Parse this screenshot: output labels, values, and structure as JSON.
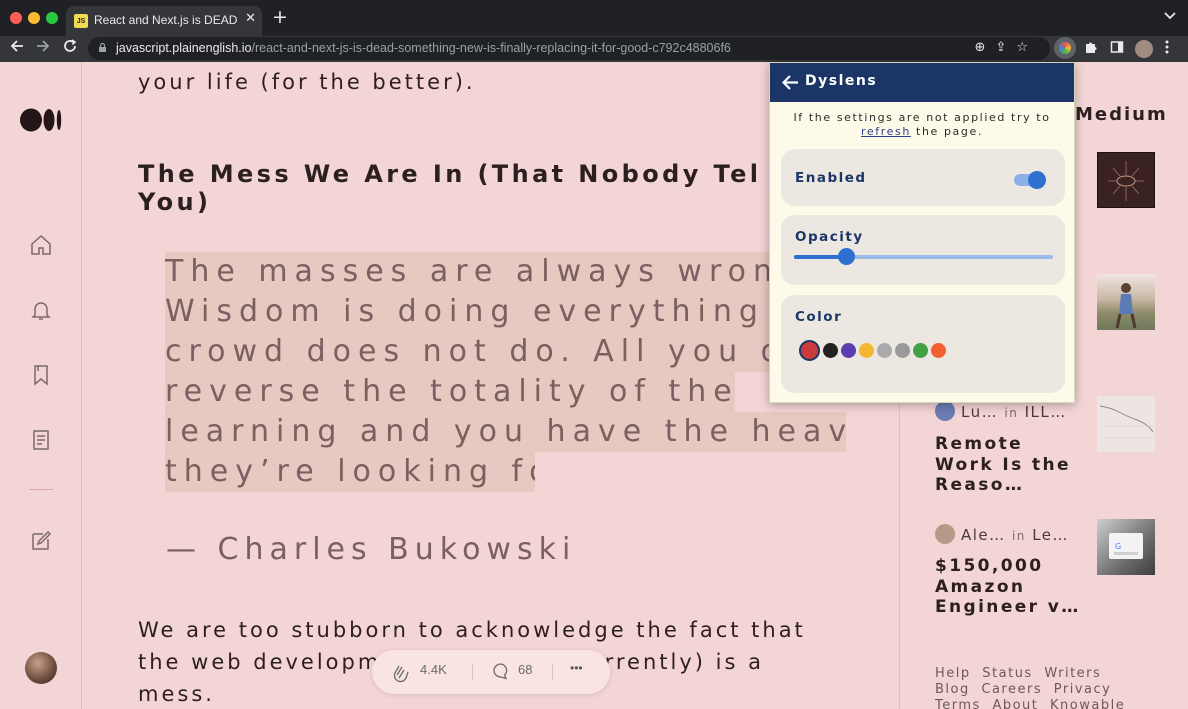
{
  "browser": {
    "tab_title": "React and Next.js is DEAD — Something New Is Finally Replacing It",
    "tab_favicon_text": "JS",
    "tab_close": "✕",
    "new_tab": "+",
    "url_domain": "javascript.plainenglish.io",
    "url_path": "/react-and-next-js-is-dead-something-new-is-finally-replacing-it-for-good-c792c48806f6",
    "icons": [
      "arrow-left-icon",
      "arrow-right-icon",
      "reload-icon",
      "lock-icon",
      "zoom-icon",
      "share-icon",
      "star-icon",
      "dyslens-extension-icon",
      "puzzle-icon",
      "side-panel-icon",
      "profile-avatar",
      "more-menu-icon"
    ]
  },
  "article": {
    "intro_tail": "your life (for the better).",
    "heading_line1": "The Mess We Are In (That Nobody Tel",
    "heading_line2": "You)",
    "quote_lines": [
      "The masses are always wrong.",
      "Wisdom is doing everything th",
      "crowd does not do. All you do",
      "reverse the totality of their",
      "learning and you have the heaven",
      "they’re looking for."
    ],
    "quote_attribution": "— Charles Bukowski",
    "paragraph": "We are too stubborn to acknowledge the fact that the web development situation (currently) is a mess."
  },
  "clap_bar": {
    "claps": "4.4K",
    "responses": "68",
    "more": "•••"
  },
  "right_column": {
    "heading_fragment": "Medium",
    "stories": [
      {
        "author": "Lu…",
        "in_word": "in",
        "publication": "ILL…",
        "title": "Remote Work Is the Reaso…"
      },
      {
        "author": "Ale…",
        "in_word": "in",
        "publication": "Le…",
        "title": "$150,000 Amazon Engineer v…"
      }
    ],
    "footer_links": [
      "Help",
      "Status",
      "Writers",
      "Blog",
      "Careers",
      "Privacy",
      "Terms",
      "About",
      "Knowable"
    ]
  },
  "dyslens": {
    "title": "Dyslens",
    "note_before_link": "If the settings are not applied try to",
    "note_link": "refresh",
    "note_after_link": "the page.",
    "enabled_label": "Enabled",
    "enabled": true,
    "opacity_label": "Opacity",
    "opacity_value": 0.2,
    "color_label": "Color",
    "colors": [
      "#cc3b3b",
      "#222222",
      "#5b3fb0",
      "#f5b731",
      "#aaaaaa",
      "#999999",
      "#43a047",
      "#f06030"
    ],
    "selected_color_index": 0
  },
  "colors": {
    "page_background": "#f4d5d5",
    "popup_header": "#1b3666",
    "accent_blue": "#2e6fd1",
    "highlight": "#e7c9c2"
  }
}
